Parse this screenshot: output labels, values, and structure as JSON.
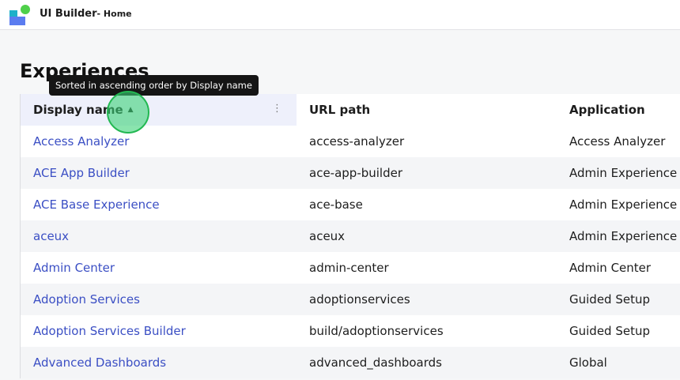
{
  "app": {
    "title": "UI Builder",
    "subtitle": "- Home"
  },
  "page": {
    "title": "Experiences"
  },
  "tooltip": "Sorted in ascending order by Display name",
  "table": {
    "columns": [
      "Display name",
      "URL path",
      "Application"
    ],
    "rows": [
      {
        "name": "Access Analyzer",
        "url": "access-analyzer",
        "app": "Access Analyzer"
      },
      {
        "name": "ACE App Builder",
        "url": "ace-app-builder",
        "app": "Admin Experience"
      },
      {
        "name": "ACE Base Experience",
        "url": "ace-base",
        "app": "Admin Experience"
      },
      {
        "name": "aceux",
        "url": "aceux",
        "app": "Admin Experience"
      },
      {
        "name": "Admin Center",
        "url": "admin-center",
        "app": "Admin Center"
      },
      {
        "name": "Adoption Services",
        "url": "adoptionservices",
        "app": "Guided Setup"
      },
      {
        "name": "Adoption Services Builder",
        "url": "build/adoptionservices",
        "app": "Guided Setup"
      },
      {
        "name": "Advanced Dashboards",
        "url": "advanced_dashboards",
        "app": "Global"
      }
    ]
  }
}
